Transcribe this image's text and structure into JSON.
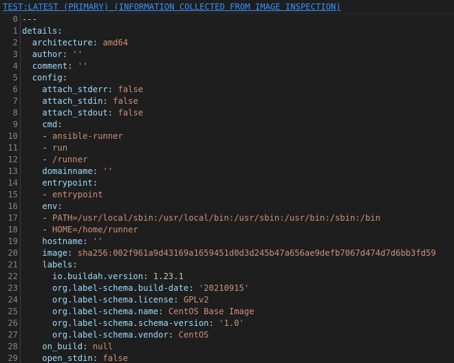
{
  "header": {
    "title": "TEST:LATEST (PRIMARY) (INFORMATION COLLECTED FROM IMAGE INSPECTION)"
  },
  "colors": {
    "background": "#1e1e1e",
    "key": "#9cdcfe",
    "string": "#ce9178",
    "number": "#b5cea8",
    "keyword": "#569cd6",
    "line_number": "#858585",
    "header_link": "#3794ff"
  },
  "lines": [
    {
      "n": "0",
      "indent": "",
      "tokens": [
        {
          "t": "---",
          "c": "p"
        }
      ]
    },
    {
      "n": "1",
      "indent": "",
      "tokens": [
        {
          "t": "details",
          "c": "k"
        },
        {
          "t": ":",
          "c": "p"
        }
      ]
    },
    {
      "n": "2",
      "indent": "  ",
      "tokens": [
        {
          "t": "architecture",
          "c": "k"
        },
        {
          "t": ": ",
          "c": "p"
        },
        {
          "t": "amd64",
          "c": "s"
        }
      ]
    },
    {
      "n": "3",
      "indent": "  ",
      "tokens": [
        {
          "t": "author",
          "c": "k"
        },
        {
          "t": ": ",
          "c": "p"
        },
        {
          "t": "''",
          "c": "s"
        }
      ]
    },
    {
      "n": "4",
      "indent": "  ",
      "tokens": [
        {
          "t": "comment",
          "c": "k"
        },
        {
          "t": ": ",
          "c": "p"
        },
        {
          "t": "''",
          "c": "s"
        }
      ]
    },
    {
      "n": "5",
      "indent": "  ",
      "tokens": [
        {
          "t": "config",
          "c": "k"
        },
        {
          "t": ":",
          "c": "p"
        }
      ]
    },
    {
      "n": "6",
      "indent": "    ",
      "tokens": [
        {
          "t": "attach_stderr",
          "c": "k"
        },
        {
          "t": ": ",
          "c": "p"
        },
        {
          "t": "false",
          "c": "s"
        }
      ]
    },
    {
      "n": "7",
      "indent": "    ",
      "tokens": [
        {
          "t": "attach_stdin",
          "c": "k"
        },
        {
          "t": ": ",
          "c": "p"
        },
        {
          "t": "false",
          "c": "s"
        }
      ]
    },
    {
      "n": "8",
      "indent": "    ",
      "tokens": [
        {
          "t": "attach_stdout",
          "c": "k"
        },
        {
          "t": ": ",
          "c": "p"
        },
        {
          "t": "false",
          "c": "s"
        }
      ]
    },
    {
      "n": "9",
      "indent": "    ",
      "tokens": [
        {
          "t": "cmd",
          "c": "k"
        },
        {
          "t": ":",
          "c": "p"
        }
      ]
    },
    {
      "n": "10",
      "indent": "    ",
      "tokens": [
        {
          "t": "- ",
          "c": "p"
        },
        {
          "t": "ansible-runner",
          "c": "s"
        }
      ]
    },
    {
      "n": "11",
      "indent": "    ",
      "tokens": [
        {
          "t": "- ",
          "c": "p"
        },
        {
          "t": "run",
          "c": "s"
        }
      ]
    },
    {
      "n": "12",
      "indent": "    ",
      "tokens": [
        {
          "t": "- ",
          "c": "p"
        },
        {
          "t": "/runner",
          "c": "s"
        }
      ]
    },
    {
      "n": "13",
      "indent": "    ",
      "tokens": [
        {
          "t": "domainname",
          "c": "k"
        },
        {
          "t": ": ",
          "c": "p"
        },
        {
          "t": "''",
          "c": "s"
        }
      ]
    },
    {
      "n": "14",
      "indent": "    ",
      "tokens": [
        {
          "t": "entrypoint",
          "c": "k"
        },
        {
          "t": ":",
          "c": "p"
        }
      ]
    },
    {
      "n": "15",
      "indent": "    ",
      "tokens": [
        {
          "t": "- ",
          "c": "p"
        },
        {
          "t": "entrypoint",
          "c": "s"
        }
      ]
    },
    {
      "n": "16",
      "indent": "    ",
      "tokens": [
        {
          "t": "env",
          "c": "k"
        },
        {
          "t": ":",
          "c": "p"
        }
      ]
    },
    {
      "n": "17",
      "indent": "    ",
      "tokens": [
        {
          "t": "- ",
          "c": "p"
        },
        {
          "t": "PATH=/usr/local/sbin:/usr/local/bin:/usr/sbin:/usr/bin:/sbin:/bin",
          "c": "s"
        }
      ]
    },
    {
      "n": "18",
      "indent": "    ",
      "tokens": [
        {
          "t": "- ",
          "c": "p"
        },
        {
          "t": "HOME=/home/runner",
          "c": "s"
        }
      ]
    },
    {
      "n": "19",
      "indent": "    ",
      "tokens": [
        {
          "t": "hostname",
          "c": "k"
        },
        {
          "t": ": ",
          "c": "p"
        },
        {
          "t": "''",
          "c": "s"
        }
      ]
    },
    {
      "n": "20",
      "indent": "    ",
      "tokens": [
        {
          "t": "image",
          "c": "k"
        },
        {
          "t": ": ",
          "c": "p"
        },
        {
          "t": "sha256:002f961a9d43169a1659451d0d3d245b47a656ae9defb7067d474d7d6bb3fd59",
          "c": "s"
        }
      ]
    },
    {
      "n": "21",
      "indent": "    ",
      "tokens": [
        {
          "t": "labels",
          "c": "k"
        },
        {
          "t": ":",
          "c": "p"
        }
      ]
    },
    {
      "n": "22",
      "indent": "      ",
      "tokens": [
        {
          "t": "io.buildah.version",
          "c": "k"
        },
        {
          "t": ": ",
          "c": "p"
        },
        {
          "t": "1.23.1",
          "c": "n"
        }
      ]
    },
    {
      "n": "23",
      "indent": "      ",
      "tokens": [
        {
          "t": "org.label-schema.build-date",
          "c": "k"
        },
        {
          "t": ": ",
          "c": "p"
        },
        {
          "t": "'20210915'",
          "c": "s"
        }
      ]
    },
    {
      "n": "24",
      "indent": "      ",
      "tokens": [
        {
          "t": "org.label-schema.license",
          "c": "k"
        },
        {
          "t": ": ",
          "c": "p"
        },
        {
          "t": "GPLv2",
          "c": "s"
        }
      ]
    },
    {
      "n": "25",
      "indent": "      ",
      "tokens": [
        {
          "t": "org.label-schema.name",
          "c": "k"
        },
        {
          "t": ": ",
          "c": "p"
        },
        {
          "t": "CentOS Base Image",
          "c": "s"
        }
      ]
    },
    {
      "n": "26",
      "indent": "      ",
      "tokens": [
        {
          "t": "org.label-schema.schema-version",
          "c": "k"
        },
        {
          "t": ": ",
          "c": "p"
        },
        {
          "t": "'1.0'",
          "c": "s"
        }
      ]
    },
    {
      "n": "27",
      "indent": "      ",
      "tokens": [
        {
          "t": "org.label-schema.vendor",
          "c": "k"
        },
        {
          "t": ": ",
          "c": "p"
        },
        {
          "t": "CentOS",
          "c": "s"
        }
      ]
    },
    {
      "n": "28",
      "indent": "    ",
      "tokens": [
        {
          "t": "on_build",
          "c": "k"
        },
        {
          "t": ": ",
          "c": "p"
        },
        {
          "t": "null",
          "c": "s"
        }
      ]
    },
    {
      "n": "29",
      "indent": "    ",
      "tokens": [
        {
          "t": "open_stdin",
          "c": "k"
        },
        {
          "t": ": ",
          "c": "p"
        },
        {
          "t": "false",
          "c": "s"
        }
      ]
    }
  ]
}
